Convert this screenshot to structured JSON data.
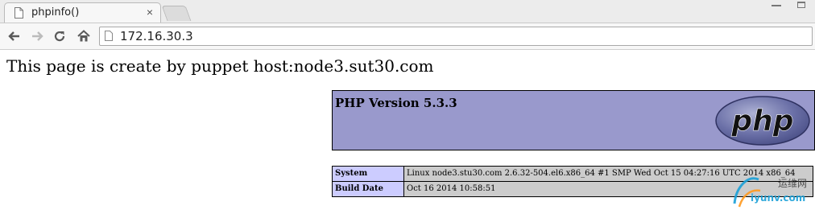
{
  "browser": {
    "tab_title": "phpinfo()",
    "tab_close": "×",
    "address": "172.16.30.3"
  },
  "page": {
    "heading": "This page is create by puppet host:node3.sut30.com",
    "php_version": "PHP Version 5.3.3",
    "logo_text": "php",
    "info_rows": [
      {
        "key": "System",
        "value": "Linux node3.stu30.com 2.6.32-504.el6.x86_64 #1 SMP Wed Oct 15 04:27:16 UTC 2014 x86_64"
      },
      {
        "key": "Build Date",
        "value": "Oct 16 2014 10:58:51"
      }
    ]
  },
  "watermark": {
    "line1": "运维网",
    "line2": "iyunv.com"
  },
  "colors": {
    "php_header_bg": "#9999cc",
    "info_key_bg": "#ccccff",
    "info_value_bg": "#cccccc"
  }
}
